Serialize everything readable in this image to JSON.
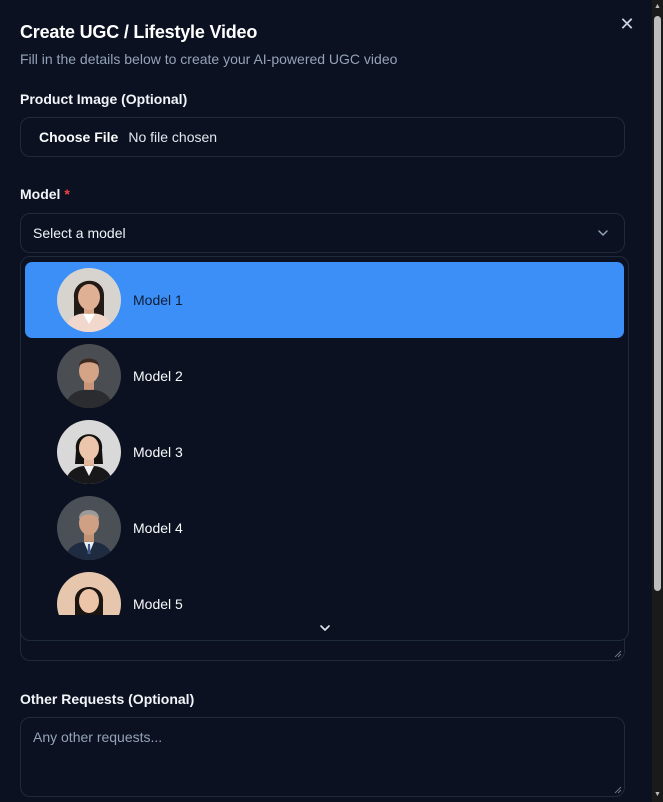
{
  "dialog": {
    "title": "Create UGC / Lifestyle Video",
    "subtitle": "Fill in the details below to create your AI-powered UGC video",
    "close_icon": "close-icon"
  },
  "product_image": {
    "label": "Product Image (Optional)",
    "choose_label": "Choose File",
    "status": "No file chosen"
  },
  "model": {
    "label": "Model",
    "required_mark": "*",
    "selected": "Select a model",
    "options": [
      {
        "label": "Model 1",
        "active": true
      },
      {
        "label": "Model 2",
        "active": false
      },
      {
        "label": "Model 3",
        "active": false
      },
      {
        "label": "Model 4",
        "active": false
      },
      {
        "label": "Model 5",
        "active": false
      }
    ]
  },
  "other_requests": {
    "label": "Other Requests (Optional)",
    "placeholder": "Any other requests..."
  },
  "colors": {
    "background": "#0b1120",
    "accent": "#3b8ff6",
    "border": "#1f2a3a",
    "required": "#ef4444"
  }
}
